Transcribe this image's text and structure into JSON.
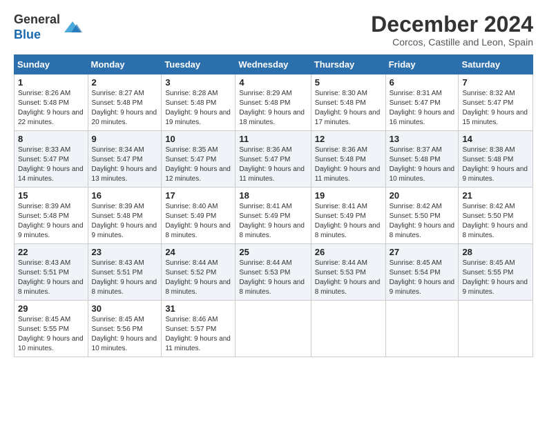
{
  "header": {
    "logo_line1": "General",
    "logo_line2": "Blue",
    "main_title": "December 2024",
    "subtitle": "Corcos, Castille and Leon, Spain"
  },
  "calendar": {
    "days_of_week": [
      "Sunday",
      "Monday",
      "Tuesday",
      "Wednesday",
      "Thursday",
      "Friday",
      "Saturday"
    ],
    "weeks": [
      [
        {
          "day": "1",
          "sunrise": "Sunrise: 8:26 AM",
          "sunset": "Sunset: 5:48 PM",
          "daylight": "Daylight: 9 hours and 22 minutes."
        },
        {
          "day": "2",
          "sunrise": "Sunrise: 8:27 AM",
          "sunset": "Sunset: 5:48 PM",
          "daylight": "Daylight: 9 hours and 20 minutes."
        },
        {
          "day": "3",
          "sunrise": "Sunrise: 8:28 AM",
          "sunset": "Sunset: 5:48 PM",
          "daylight": "Daylight: 9 hours and 19 minutes."
        },
        {
          "day": "4",
          "sunrise": "Sunrise: 8:29 AM",
          "sunset": "Sunset: 5:48 PM",
          "daylight": "Daylight: 9 hours and 18 minutes."
        },
        {
          "day": "5",
          "sunrise": "Sunrise: 8:30 AM",
          "sunset": "Sunset: 5:48 PM",
          "daylight": "Daylight: 9 hours and 17 minutes."
        },
        {
          "day": "6",
          "sunrise": "Sunrise: 8:31 AM",
          "sunset": "Sunset: 5:47 PM",
          "daylight": "Daylight: 9 hours and 16 minutes."
        },
        {
          "day": "7",
          "sunrise": "Sunrise: 8:32 AM",
          "sunset": "Sunset: 5:47 PM",
          "daylight": "Daylight: 9 hours and 15 minutes."
        }
      ],
      [
        {
          "day": "8",
          "sunrise": "Sunrise: 8:33 AM",
          "sunset": "Sunset: 5:47 PM",
          "daylight": "Daylight: 9 hours and 14 minutes."
        },
        {
          "day": "9",
          "sunrise": "Sunrise: 8:34 AM",
          "sunset": "Sunset: 5:47 PM",
          "daylight": "Daylight: 9 hours and 13 minutes."
        },
        {
          "day": "10",
          "sunrise": "Sunrise: 8:35 AM",
          "sunset": "Sunset: 5:47 PM",
          "daylight": "Daylight: 9 hours and 12 minutes."
        },
        {
          "day": "11",
          "sunrise": "Sunrise: 8:36 AM",
          "sunset": "Sunset: 5:47 PM",
          "daylight": "Daylight: 9 hours and 11 minutes."
        },
        {
          "day": "12",
          "sunrise": "Sunrise: 8:36 AM",
          "sunset": "Sunset: 5:48 PM",
          "daylight": "Daylight: 9 hours and 11 minutes."
        },
        {
          "day": "13",
          "sunrise": "Sunrise: 8:37 AM",
          "sunset": "Sunset: 5:48 PM",
          "daylight": "Daylight: 9 hours and 10 minutes."
        },
        {
          "day": "14",
          "sunrise": "Sunrise: 8:38 AM",
          "sunset": "Sunset: 5:48 PM",
          "daylight": "Daylight: 9 hours and 9 minutes."
        }
      ],
      [
        {
          "day": "15",
          "sunrise": "Sunrise: 8:39 AM",
          "sunset": "Sunset: 5:48 PM",
          "daylight": "Daylight: 9 hours and 9 minutes."
        },
        {
          "day": "16",
          "sunrise": "Sunrise: 8:39 AM",
          "sunset": "Sunset: 5:48 PM",
          "daylight": "Daylight: 9 hours and 9 minutes."
        },
        {
          "day": "17",
          "sunrise": "Sunrise: 8:40 AM",
          "sunset": "Sunset: 5:49 PM",
          "daylight": "Daylight: 9 hours and 8 minutes."
        },
        {
          "day": "18",
          "sunrise": "Sunrise: 8:41 AM",
          "sunset": "Sunset: 5:49 PM",
          "daylight": "Daylight: 9 hours and 8 minutes."
        },
        {
          "day": "19",
          "sunrise": "Sunrise: 8:41 AM",
          "sunset": "Sunset: 5:49 PM",
          "daylight": "Daylight: 9 hours and 8 minutes."
        },
        {
          "day": "20",
          "sunrise": "Sunrise: 8:42 AM",
          "sunset": "Sunset: 5:50 PM",
          "daylight": "Daylight: 9 hours and 8 minutes."
        },
        {
          "day": "21",
          "sunrise": "Sunrise: 8:42 AM",
          "sunset": "Sunset: 5:50 PM",
          "daylight": "Daylight: 9 hours and 8 minutes."
        }
      ],
      [
        {
          "day": "22",
          "sunrise": "Sunrise: 8:43 AM",
          "sunset": "Sunset: 5:51 PM",
          "daylight": "Daylight: 9 hours and 8 minutes."
        },
        {
          "day": "23",
          "sunrise": "Sunrise: 8:43 AM",
          "sunset": "Sunset: 5:51 PM",
          "daylight": "Daylight: 9 hours and 8 minutes."
        },
        {
          "day": "24",
          "sunrise": "Sunrise: 8:44 AM",
          "sunset": "Sunset: 5:52 PM",
          "daylight": "Daylight: 9 hours and 8 minutes."
        },
        {
          "day": "25",
          "sunrise": "Sunrise: 8:44 AM",
          "sunset": "Sunset: 5:53 PM",
          "daylight": "Daylight: 9 hours and 8 minutes."
        },
        {
          "day": "26",
          "sunrise": "Sunrise: 8:44 AM",
          "sunset": "Sunset: 5:53 PM",
          "daylight": "Daylight: 9 hours and 8 minutes."
        },
        {
          "day": "27",
          "sunrise": "Sunrise: 8:45 AM",
          "sunset": "Sunset: 5:54 PM",
          "daylight": "Daylight: 9 hours and 9 minutes."
        },
        {
          "day": "28",
          "sunrise": "Sunrise: 8:45 AM",
          "sunset": "Sunset: 5:55 PM",
          "daylight": "Daylight: 9 hours and 9 minutes."
        }
      ],
      [
        {
          "day": "29",
          "sunrise": "Sunrise: 8:45 AM",
          "sunset": "Sunset: 5:55 PM",
          "daylight": "Daylight: 9 hours and 10 minutes."
        },
        {
          "day": "30",
          "sunrise": "Sunrise: 8:45 AM",
          "sunset": "Sunset: 5:56 PM",
          "daylight": "Daylight: 9 hours and 10 minutes."
        },
        {
          "day": "31",
          "sunrise": "Sunrise: 8:46 AM",
          "sunset": "Sunset: 5:57 PM",
          "daylight": "Daylight: 9 hours and 11 minutes."
        },
        null,
        null,
        null,
        null
      ]
    ]
  }
}
